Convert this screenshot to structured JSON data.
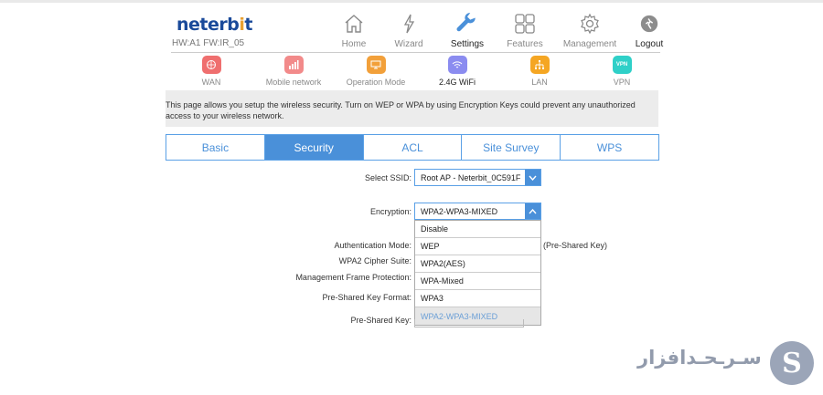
{
  "brand": {
    "logo_text_a": "neterb",
    "logo_text_b": "i",
    "logo_text_c": "t",
    "hw_info": "HW:A1 FW:IR_05"
  },
  "main_nav": [
    {
      "label": "Home",
      "icon": "home-icon"
    },
    {
      "label": "Wizard",
      "icon": "wizard-icon"
    },
    {
      "label": "Settings",
      "icon": "settings-icon",
      "active": true
    },
    {
      "label": "Features",
      "icon": "features-icon"
    },
    {
      "label": "Management",
      "icon": "gear-icon"
    },
    {
      "label": "Logout",
      "icon": "logout-icon"
    }
  ],
  "sub_nav": [
    {
      "label": "WAN",
      "color": "#ef6f6f"
    },
    {
      "label": "Mobile network",
      "color": "#f28a8a"
    },
    {
      "label": "Operation Mode",
      "color": "#f2a03a"
    },
    {
      "label": "2.4G WiFi",
      "color": "#8b8cf0",
      "active": true
    },
    {
      "label": "LAN",
      "color": "#f5a623"
    },
    {
      "label": "VPN",
      "color": "#2fd0c8",
      "badge": "VPN"
    }
  ],
  "info_text": "This page allows you setup the wireless security. Turn on WEP or WPA by using Encryption Keys could prevent any unauthorized access to your wireless network.",
  "tabs": [
    "Basic",
    "Security",
    "ACL",
    "Site Survey",
    "WPS"
  ],
  "active_tab": "Security",
  "form": {
    "ssid_label": "Select SSID:",
    "ssid_value": "Root AP - Neterbit_0C591F",
    "encryption_label": "Encryption:",
    "encryption_value": "WPA2-WPA3-MIXED",
    "auth_label": "Authentication Mode:",
    "auth_suffix": "(Pre-Shared Key)",
    "cipher_label": "WPA2 Cipher Suite:",
    "mfp_label": "Management Frame Protection:",
    "psk_format_label": "Pre-Shared Key Format:",
    "psk_label": "Pre-Shared Key:"
  },
  "encryption_options": [
    "Disable",
    "WEP",
    "WPA2(AES)",
    "WPA-Mixed",
    "WPA3",
    "WPA2-WPA3-MIXED"
  ],
  "watermark": {
    "text": "سـرـحـدافزار",
    "letter": "S"
  },
  "colors": {
    "accent": "#4a90d9",
    "brand": "#1a4a9a"
  }
}
